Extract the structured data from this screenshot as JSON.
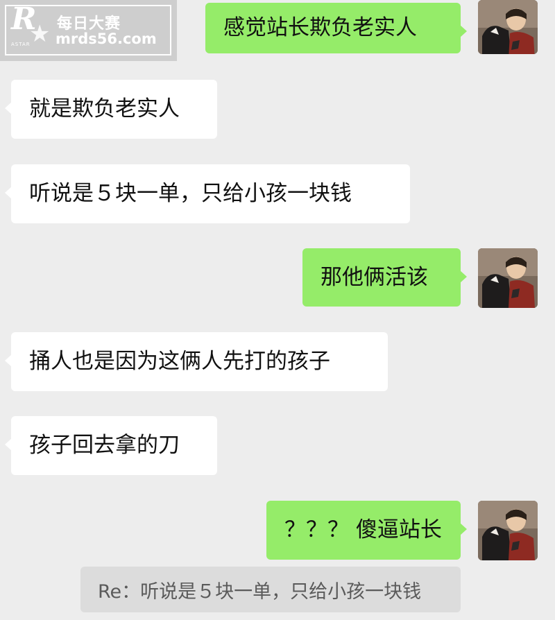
{
  "watermark": {
    "logo_letter": "R",
    "logo_small": "ASTAR",
    "title": "每日大赛",
    "site": "mrds56.com"
  },
  "messages": [
    {
      "side": "right",
      "text": "感觉站长欺负老实人"
    },
    {
      "side": "left",
      "text": "就是欺负老实人"
    },
    {
      "side": "left",
      "text": "听说是５块一单，只给小孩一块钱"
    },
    {
      "side": "right",
      "text": "那他俩活该"
    },
    {
      "side": "left",
      "text": "捅人也是因为这俩人先打的孩子"
    },
    {
      "side": "left",
      "text": "孩子回去拿的刀"
    },
    {
      "side": "right",
      "text": "？？？ 傻逼站长"
    }
  ],
  "quote": {
    "text": "Re：听说是５块一单，只给小孩一块钱"
  },
  "colors": {
    "background": "#ededed",
    "outgoing_bubble": "#95ec69",
    "incoming_bubble": "#ffffff",
    "quote_bg": "#dcdcdc"
  }
}
